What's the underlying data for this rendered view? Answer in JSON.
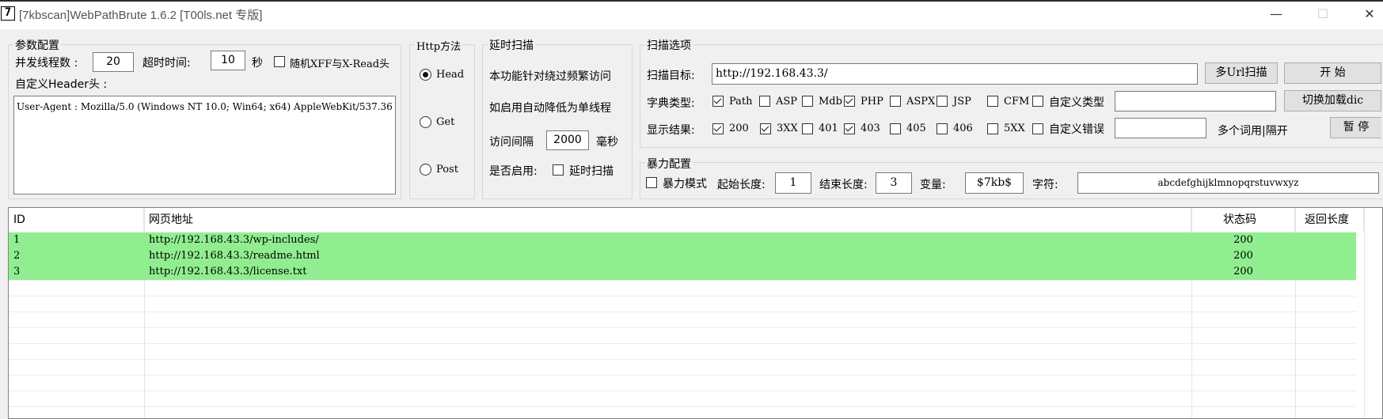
{
  "window": {
    "icon": "7",
    "title": "[7kbscan]WebPathBrute 1.6.2 [T00ls.net 专版]",
    "min_glyph": "—",
    "max_glyph": "☐",
    "close_glyph": "✕"
  },
  "params": {
    "legend": "参数配置",
    "threads_label": "并发线程数 :",
    "threads_value": "20",
    "timeout_label": "超时时间:",
    "timeout_value": "10",
    "timeout_unit": "秒",
    "random_xff_label": "随机XFF与X-Read头",
    "random_xff_checked": false,
    "header_label": "自定义Header头 :",
    "header_value": "User-Agent : Mozilla/5.0 (Windows NT 10.0; Win64; x64) AppleWebKit/537.36"
  },
  "http_method": {
    "legend": "Http方法",
    "options": [
      "Head",
      "Get",
      "Post"
    ],
    "selected": "Head"
  },
  "delay_scan": {
    "legend": "延时扫描",
    "line1": "本功能针对绕过频繁访问",
    "line2": "如启用自动降低为单线程",
    "interval_label": "访问间隔",
    "interval_value": "2000",
    "interval_unit": "毫秒",
    "enable_label": "是否启用:",
    "enable_checkbox_label": "延时扫描",
    "enabled": false
  },
  "scan_options": {
    "legend": "扫描选项",
    "target_label": "扫描目标:",
    "target_value": "http://192.168.43.3/",
    "multi_url_button": "多Url扫描",
    "start_button": "开 始",
    "dict_type_label": "字典类型:",
    "dict_types": [
      {
        "label": "Path",
        "checked": true
      },
      {
        "label": "ASP",
        "checked": false
      },
      {
        "label": "Mdb",
        "checked": false
      },
      {
        "label": "PHP",
        "checked": true
      },
      {
        "label": "ASPX",
        "checked": false
      },
      {
        "label": "JSP",
        "checked": false
      },
      {
        "label": "CFM",
        "checked": false
      },
      {
        "label": "自定义类型",
        "checked": false
      }
    ],
    "custom_type_value": "",
    "switch_dict_button": "切换加载dic",
    "show_result_label": "显示结果:",
    "results": [
      {
        "label": "200",
        "checked": true
      },
      {
        "label": "3XX",
        "checked": true
      },
      {
        "label": "401",
        "checked": false
      },
      {
        "label": "403",
        "checked": true
      },
      {
        "label": "405",
        "checked": false
      },
      {
        "label": "406",
        "checked": false
      },
      {
        "label": "5XX",
        "checked": false
      },
      {
        "label": "自定义错误",
        "checked": false
      }
    ],
    "custom_error_value": "",
    "multi_word_label": "多个词用|隔开",
    "pause_button": "暂 停"
  },
  "brute": {
    "legend": "暴力配置",
    "mode_label": "暴力模式",
    "mode_checked": false,
    "start_len_label": "起始长度:",
    "start_len_value": "1",
    "end_len_label": "结束长度:",
    "end_len_value": "3",
    "var_label": "变量:",
    "var_value": "$7kb$",
    "chars_label": "字符:",
    "chars_value": "abcdefghijklmnopqrstuvwxyz"
  },
  "table": {
    "columns": [
      "ID",
      "网页地址",
      "状态码",
      "返回长度"
    ],
    "rows": [
      {
        "id": "1",
        "url": "http://192.168.43.3/wp-includes/",
        "status": "200",
        "length": ""
      },
      {
        "id": "2",
        "url": "http://192.168.43.3/readme.html",
        "status": "200",
        "length": ""
      },
      {
        "id": "3",
        "url": "http://192.168.43.3/license.txt",
        "status": "200",
        "length": ""
      }
    ],
    "highlight_color": "#90ee90"
  }
}
